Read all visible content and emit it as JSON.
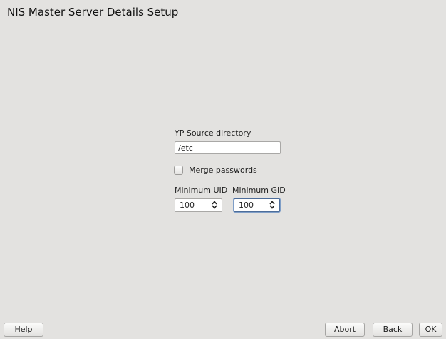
{
  "window": {
    "title": "NIS Master Server Details Setup"
  },
  "form": {
    "yp_source_label": "YP Source directory",
    "yp_source_value": "/etc",
    "merge_passwords_label": "Merge passwords",
    "merge_passwords_checked": false,
    "min_uid_label": "Minimum UID",
    "min_uid_value": "100",
    "min_gid_label": "Minimum GID",
    "min_gid_value": "100"
  },
  "buttons": {
    "help": "Help",
    "abort": "Abort",
    "back": "Back",
    "ok": "OK"
  }
}
